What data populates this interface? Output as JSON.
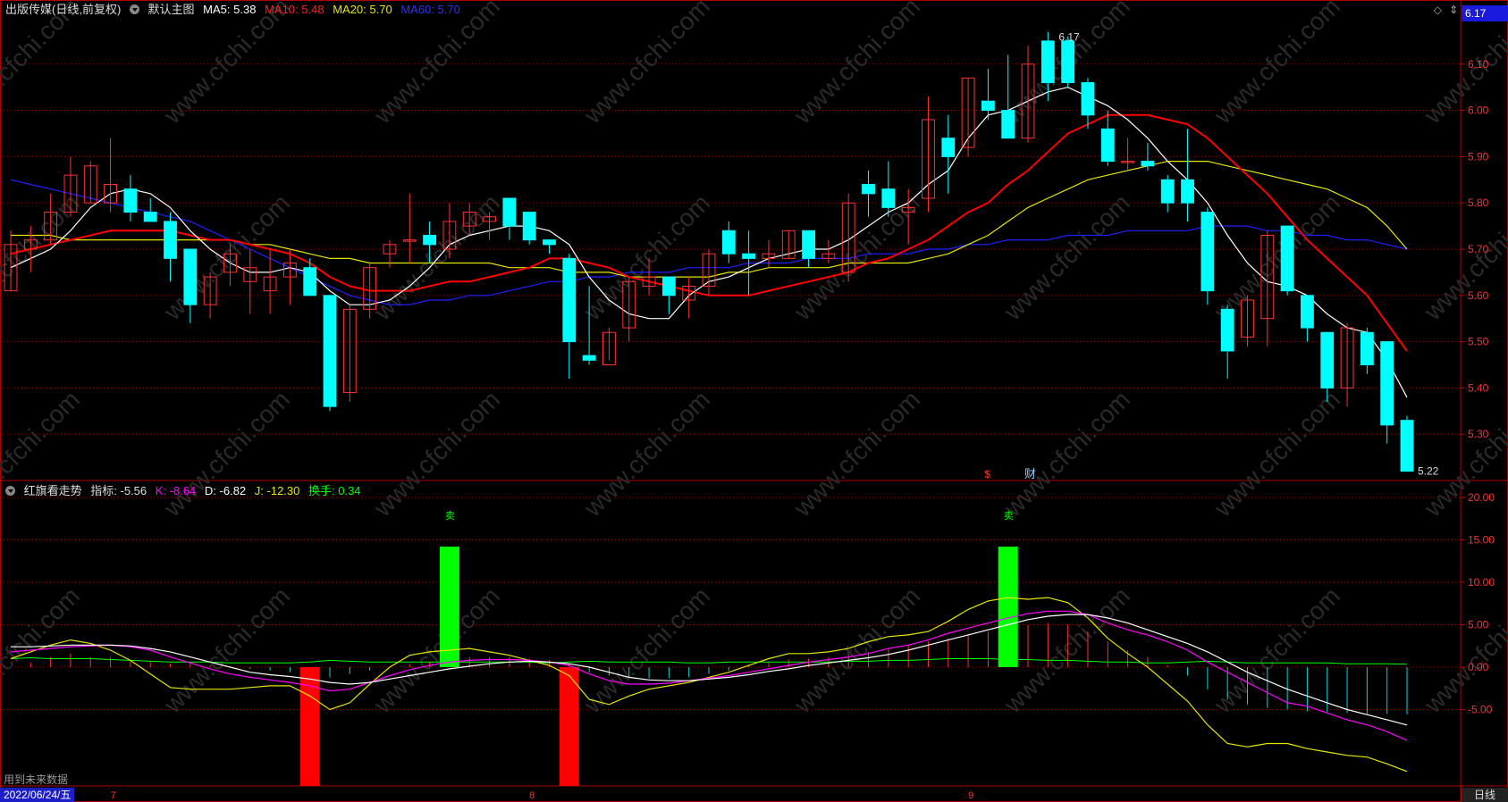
{
  "main_legend": {
    "title": "出版传媒(日线,前复权)",
    "template": "默认主图",
    "ma5": "MA5: 5.38",
    "ma10": "MA10: 5.48",
    "ma20": "MA20: 5.70",
    "ma60": "MA60: 5.70"
  },
  "current_price_tag": "6.17",
  "price_axis_ticks": [
    "6.10",
    "6.00",
    "5.90",
    "5.80",
    "5.70",
    "5.60",
    "5.50",
    "5.40",
    "5.30"
  ],
  "indicator_axis_ticks": [
    "20.00",
    "15.00",
    "10.00",
    "5.00",
    "0.00",
    "-5.00"
  ],
  "indicator_legend": {
    "name": "红旗看走势",
    "zhibiao": "指标: -5.56",
    "k": "K: -8.64",
    "d": "D: -6.82",
    "j": "J: -12.30",
    "turnover": "换手: 0.34"
  },
  "markers": {
    "high_label": "6.17",
    "low_label": "5.22",
    "event_s": "$",
    "event_cai": "财",
    "sell_1": "卖",
    "sell_2": "卖"
  },
  "bottom_bar": {
    "date": "2022/06/24/五",
    "month_7": "7",
    "month_8": "8",
    "month_9": "9",
    "period": "日线",
    "future_data": "用到未来数据"
  },
  "watermark": "www.cfchi.com",
  "colors": {
    "up": "#ff3232",
    "down": "#00ffff",
    "ma5": "#ffffff",
    "ma10": "#ff0000",
    "ma20": "#e6e600",
    "ma60": "#2020ff",
    "grid": "#8b0000",
    "signal_green": "#00ff00",
    "signal_red": "#ff0000",
    "k": "#ff00ff",
    "j": "#e6e600",
    "d": "#ffffff"
  },
  "chart_data": {
    "type": "candlestick",
    "price_ylim": [
      5.2,
      6.2
    ],
    "indicator_ylim": [
      -14,
      22
    ],
    "candles": [
      {
        "o": 5.61,
        "h": 5.74,
        "l": 5.61,
        "c": 5.71
      },
      {
        "o": 5.7,
        "h": 5.75,
        "l": 5.65,
        "c": 5.72
      },
      {
        "o": 5.72,
        "h": 5.82,
        "l": 5.71,
        "c": 5.78
      },
      {
        "o": 5.78,
        "h": 5.9,
        "l": 5.77,
        "c": 5.86
      },
      {
        "o": 5.8,
        "h": 5.89,
        "l": 5.8,
        "c": 5.88
      },
      {
        "o": 5.8,
        "h": 5.94,
        "l": 5.78,
        "c": 5.84
      },
      {
        "o": 5.83,
        "h": 5.86,
        "l": 5.76,
        "c": 5.78
      },
      {
        "o": 5.78,
        "h": 5.81,
        "l": 5.76,
        "c": 5.76
      },
      {
        "o": 5.76,
        "h": 5.78,
        "l": 5.63,
        "c": 5.68
      },
      {
        "o": 5.7,
        "h": 5.7,
        "l": 5.54,
        "c": 5.58
      },
      {
        "o": 5.58,
        "h": 5.65,
        "l": 5.55,
        "c": 5.64
      },
      {
        "o": 5.65,
        "h": 5.71,
        "l": 5.62,
        "c": 5.69
      },
      {
        "o": 5.63,
        "h": 5.7,
        "l": 5.56,
        "c": 5.66
      },
      {
        "o": 5.61,
        "h": 5.7,
        "l": 5.56,
        "c": 5.64
      },
      {
        "o": 5.64,
        "h": 5.7,
        "l": 5.58,
        "c": 5.67
      },
      {
        "o": 5.66,
        "h": 5.68,
        "l": 5.6,
        "c": 5.6
      },
      {
        "o": 5.6,
        "h": 5.6,
        "l": 5.35,
        "c": 5.36
      },
      {
        "o": 5.39,
        "h": 5.58,
        "l": 5.37,
        "c": 5.57
      },
      {
        "o": 5.57,
        "h": 5.67,
        "l": 5.55,
        "c": 5.66
      },
      {
        "o": 5.69,
        "h": 5.72,
        "l": 5.66,
        "c": 5.71
      },
      {
        "o": 5.72,
        "h": 5.82,
        "l": 5.67,
        "c": 5.72
      },
      {
        "o": 5.73,
        "h": 5.76,
        "l": 5.67,
        "c": 5.71
      },
      {
        "o": 5.7,
        "h": 5.8,
        "l": 5.68,
        "c": 5.76
      },
      {
        "o": 5.75,
        "h": 5.8,
        "l": 5.73,
        "c": 5.78
      },
      {
        "o": 5.76,
        "h": 5.78,
        "l": 5.72,
        "c": 5.77
      },
      {
        "o": 5.81,
        "h": 5.81,
        "l": 5.72,
        "c": 5.75
      },
      {
        "o": 5.78,
        "h": 5.78,
        "l": 5.71,
        "c": 5.72
      },
      {
        "o": 5.72,
        "h": 5.72,
        "l": 5.69,
        "c": 5.71
      },
      {
        "o": 5.68,
        "h": 5.69,
        "l": 5.42,
        "c": 5.5
      },
      {
        "o": 5.47,
        "h": 5.62,
        "l": 5.45,
        "c": 5.46
      },
      {
        "o": 5.45,
        "h": 5.53,
        "l": 5.46,
        "c": 5.52
      },
      {
        "o": 5.53,
        "h": 5.64,
        "l": 5.5,
        "c": 5.63
      },
      {
        "o": 5.62,
        "h": 5.68,
        "l": 5.6,
        "c": 5.64
      },
      {
        "o": 5.64,
        "h": 5.64,
        "l": 5.56,
        "c": 5.6
      },
      {
        "o": 5.59,
        "h": 5.64,
        "l": 5.55,
        "c": 5.62
      },
      {
        "o": 5.62,
        "h": 5.7,
        "l": 5.6,
        "c": 5.69
      },
      {
        "o": 5.74,
        "h": 5.76,
        "l": 5.67,
        "c": 5.69
      },
      {
        "o": 5.69,
        "h": 5.74,
        "l": 5.6,
        "c": 5.68
      },
      {
        "o": 5.68,
        "h": 5.72,
        "l": 5.66,
        "c": 5.69
      },
      {
        "o": 5.68,
        "h": 5.74,
        "l": 5.68,
        "c": 5.74
      },
      {
        "o": 5.74,
        "h": 5.74,
        "l": 5.66,
        "c": 5.68
      },
      {
        "o": 5.68,
        "h": 5.72,
        "l": 5.67,
        "c": 5.69
      },
      {
        "o": 5.65,
        "h": 5.82,
        "l": 5.63,
        "c": 5.8
      },
      {
        "o": 5.84,
        "h": 5.87,
        "l": 5.77,
        "c": 5.82
      },
      {
        "o": 5.83,
        "h": 5.89,
        "l": 5.77,
        "c": 5.79
      },
      {
        "o": 5.78,
        "h": 5.83,
        "l": 5.71,
        "c": 5.79
      },
      {
        "o": 5.81,
        "h": 6.03,
        "l": 5.78,
        "c": 5.98
      },
      {
        "o": 5.94,
        "h": 5.99,
        "l": 5.82,
        "c": 5.9
      },
      {
        "o": 5.92,
        "h": 6.07,
        "l": 5.9,
        "c": 6.07
      },
      {
        "o": 6.02,
        "h": 6.09,
        "l": 5.98,
        "c": 6.0
      },
      {
        "o": 6.0,
        "h": 6.12,
        "l": 5.95,
        "c": 5.94
      },
      {
        "o": 5.94,
        "h": 6.14,
        "l": 5.93,
        "c": 6.1
      },
      {
        "o": 6.15,
        "h": 6.17,
        "l": 6.02,
        "c": 6.06
      },
      {
        "o": 6.15,
        "h": 6.16,
        "l": 6.05,
        "c": 6.06
      },
      {
        "o": 6.06,
        "h": 6.07,
        "l": 5.96,
        "c": 5.99
      },
      {
        "o": 5.96,
        "h": 6.0,
        "l": 5.88,
        "c": 5.89
      },
      {
        "o": 5.89,
        "h": 5.94,
        "l": 5.87,
        "c": 5.89
      },
      {
        "o": 5.89,
        "h": 5.93,
        "l": 5.87,
        "c": 5.88
      },
      {
        "o": 5.85,
        "h": 5.86,
        "l": 5.78,
        "c": 5.8
      },
      {
        "o": 5.85,
        "h": 5.96,
        "l": 5.76,
        "c": 5.8
      },
      {
        "o": 5.78,
        "h": 5.79,
        "l": 5.58,
        "c": 5.61
      },
      {
        "o": 5.57,
        "h": 5.58,
        "l": 5.42,
        "c": 5.48
      },
      {
        "o": 5.51,
        "h": 5.6,
        "l": 5.49,
        "c": 5.59
      },
      {
        "o": 5.55,
        "h": 5.74,
        "l": 5.49,
        "c": 5.73
      },
      {
        "o": 5.75,
        "h": 5.75,
        "l": 5.6,
        "c": 5.61
      },
      {
        "o": 5.6,
        "h": 5.6,
        "l": 5.5,
        "c": 5.53
      },
      {
        "o": 5.52,
        "h": 5.52,
        "l": 5.37,
        "c": 5.4
      },
      {
        "o": 5.4,
        "h": 5.54,
        "l": 5.36,
        "c": 5.53
      },
      {
        "o": 5.52,
        "h": 5.53,
        "l": 5.43,
        "c": 5.45
      },
      {
        "o": 5.5,
        "h": 5.5,
        "l": 5.28,
        "c": 5.32
      },
      {
        "o": 5.33,
        "h": 5.34,
        "l": 5.22,
        "c": 5.22
      }
    ],
    "ma5": [
      5.66,
      5.68,
      5.7,
      5.74,
      5.79,
      5.82,
      5.83,
      5.82,
      5.79,
      5.74,
      5.7,
      5.67,
      5.65,
      5.65,
      5.66,
      5.65,
      5.61,
      5.58,
      5.58,
      5.59,
      5.62,
      5.66,
      5.71,
      5.73,
      5.74,
      5.75,
      5.75,
      5.74,
      5.71,
      5.64,
      5.59,
      5.56,
      5.55,
      5.55,
      5.6,
      5.63,
      5.64,
      5.66,
      5.68,
      5.69,
      5.7,
      5.7,
      5.72,
      5.75,
      5.78,
      5.8,
      5.84,
      5.87,
      5.94,
      5.99,
      6.0,
      6.02,
      6.04,
      6.05,
      6.03,
      6.01,
      5.98,
      5.94,
      5.89,
      5.85,
      5.8,
      5.73,
      5.67,
      5.63,
      5.62,
      5.6,
      5.56,
      5.53,
      5.52,
      5.46,
      5.38
    ],
    "ma10": [
      5.69,
      5.7,
      5.71,
      5.72,
      5.73,
      5.74,
      5.74,
      5.74,
      5.74,
      5.73,
      5.72,
      5.72,
      5.71,
      5.7,
      5.69,
      5.67,
      5.64,
      5.62,
      5.61,
      5.61,
      5.61,
      5.62,
      5.63,
      5.63,
      5.64,
      5.65,
      5.66,
      5.68,
      5.68,
      5.67,
      5.66,
      5.64,
      5.63,
      5.62,
      5.61,
      5.6,
      5.6,
      5.6,
      5.61,
      5.62,
      5.63,
      5.64,
      5.65,
      5.67,
      5.68,
      5.7,
      5.72,
      5.75,
      5.78,
      5.8,
      5.84,
      5.87,
      5.91,
      5.95,
      5.97,
      5.99,
      5.99,
      5.99,
      5.98,
      5.97,
      5.94,
      5.9,
      5.86,
      5.82,
      5.77,
      5.72,
      5.68,
      5.64,
      5.6,
      5.54,
      5.48
    ],
    "ma20": [
      5.73,
      5.73,
      5.73,
      5.72,
      5.72,
      5.72,
      5.72,
      5.72,
      5.72,
      5.72,
      5.72,
      5.72,
      5.71,
      5.71,
      5.7,
      5.69,
      5.68,
      5.68,
      5.67,
      5.67,
      5.67,
      5.67,
      5.67,
      5.67,
      5.67,
      5.66,
      5.66,
      5.66,
      5.65,
      5.65,
      5.65,
      5.64,
      5.64,
      5.64,
      5.64,
      5.64,
      5.65,
      5.65,
      5.66,
      5.66,
      5.66,
      5.66,
      5.67,
      5.67,
      5.67,
      5.67,
      5.68,
      5.69,
      5.71,
      5.73,
      5.76,
      5.79,
      5.81,
      5.83,
      5.85,
      5.86,
      5.87,
      5.88,
      5.89,
      5.89,
      5.89,
      5.88,
      5.87,
      5.86,
      5.85,
      5.84,
      5.83,
      5.81,
      5.79,
      5.75,
      5.7
    ],
    "ma60": [
      5.85,
      5.84,
      5.83,
      5.82,
      5.81,
      5.8,
      5.79,
      5.78,
      5.77,
      5.76,
      5.74,
      5.72,
      5.7,
      5.68,
      5.66,
      5.64,
      5.62,
      5.6,
      5.59,
      5.58,
      5.58,
      5.59,
      5.59,
      5.6,
      5.6,
      5.61,
      5.62,
      5.63,
      5.63,
      5.64,
      5.64,
      5.65,
      5.65,
      5.65,
      5.66,
      5.66,
      5.66,
      5.67,
      5.67,
      5.67,
      5.68,
      5.68,
      5.68,
      5.69,
      5.69,
      5.69,
      5.7,
      5.7,
      5.71,
      5.71,
      5.72,
      5.72,
      5.72,
      5.73,
      5.73,
      5.73,
      5.74,
      5.74,
      5.74,
      5.74,
      5.75,
      5.75,
      5.75,
      5.74,
      5.74,
      5.73,
      5.73,
      5.72,
      5.72,
      5.71,
      5.7
    ],
    "indicator": {
      "zhibiao": [
        0.0,
        0.5,
        1.2,
        1.6,
        1.2,
        1.2,
        0.8,
        0.6,
        0.4,
        0.4,
        0.2,
        0.0,
        -0.2,
        -0.4,
        -0.6,
        -1.0,
        -1.2,
        -0.8,
        -0.4,
        0.0,
        0.4,
        0.6,
        1.0,
        1.2,
        1.2,
        1.2,
        1.0,
        0.8,
        0.4,
        -0.6,
        -1.0,
        -1.2,
        -1.3,
        -1.3,
        -1.2,
        -0.8,
        -0.4,
        0.2,
        0.6,
        0.9,
        1.0,
        1.2,
        1.5,
        1.8,
        2.2,
        2.6,
        3.0,
        3.4,
        3.8,
        4.2,
        4.6,
        5.0,
        5.2,
        5.0,
        4.2,
        3.0,
        2.0,
        1.2,
        0.2,
        -1.0,
        -2.6,
        -3.8,
        -4.4,
        -4.8,
        -5.0,
        -5.2,
        -5.3,
        -5.4,
        -5.5,
        -5.5,
        -5.56
      ],
      "k": [
        1.8,
        2.0,
        2.2,
        2.4,
        2.5,
        2.6,
        2.4,
        2.0,
        1.2,
        0.5,
        -0.2,
        -0.8,
        -1.2,
        -1.5,
        -1.8,
        -2.2,
        -2.8,
        -2.6,
        -1.8,
        -1.0,
        -0.3,
        0.2,
        0.6,
        0.8,
        0.9,
        0.9,
        0.8,
        0.6,
        0.2,
        -0.8,
        -1.6,
        -2.0,
        -2.0,
        -1.9,
        -1.6,
        -1.3,
        -1.0,
        -0.6,
        -0.2,
        0.2,
        0.6,
        0.9,
        1.2,
        1.6,
        2.2,
        2.6,
        3.2,
        4.0,
        4.6,
        5.2,
        5.8,
        6.3,
        6.6,
        6.6,
        6.2,
        5.2,
        4.4,
        3.8,
        3.0,
        2.0,
        0.6,
        -0.6,
        -1.8,
        -3.0,
        -4.2,
        -4.6,
        -5.4,
        -6.2,
        -6.8,
        -7.6,
        -8.64
      ],
      "d": [
        2.4,
        2.4,
        2.5,
        2.6,
        2.6,
        2.6,
        2.5,
        2.2,
        1.8,
        1.2,
        0.6,
        0.0,
        -0.6,
        -0.9,
        -1.1,
        -1.4,
        -1.8,
        -2.0,
        -1.8,
        -1.4,
        -1.0,
        -0.6,
        -0.2,
        0.1,
        0.4,
        0.6,
        0.7,
        0.6,
        0.4,
        0.0,
        -0.6,
        -1.2,
        -1.5,
        -1.6,
        -1.6,
        -1.4,
        -1.2,
        -0.9,
        -0.5,
        -0.2,
        0.2,
        0.5,
        0.8,
        1.1,
        1.5,
        2.0,
        2.6,
        3.2,
        3.8,
        4.4,
        5.0,
        5.6,
        6.0,
        6.2,
        6.2,
        5.8,
        5.2,
        4.4,
        3.6,
        2.8,
        1.8,
        0.6,
        -0.6,
        -1.6,
        -2.6,
        -3.4,
        -4.2,
        -5.0,
        -5.6,
        -6.2,
        -6.82
      ],
      "j": [
        1.0,
        1.8,
        2.6,
        3.2,
        2.8,
        2.0,
        0.8,
        -0.8,
        -2.4,
        -2.6,
        -2.6,
        -2.6,
        -2.4,
        -2.2,
        -2.2,
        -3.4,
        -5.0,
        -4.2,
        -2.0,
        0.0,
        1.4,
        1.8,
        2.0,
        2.2,
        1.8,
        1.4,
        0.8,
        0.2,
        -1.0,
        -3.8,
        -4.4,
        -3.4,
        -2.6,
        -2.2,
        -1.8,
        -1.2,
        -0.6,
        0.2,
        1.0,
        1.6,
        1.6,
        1.8,
        2.2,
        3.0,
        3.6,
        3.8,
        4.2,
        5.4,
        6.8,
        7.8,
        8.2,
        8.0,
        8.2,
        7.6,
        5.8,
        3.4,
        1.6,
        0.0,
        -2.0,
        -4.0,
        -6.8,
        -9.0,
        -9.4,
        -9.0,
        -9.0,
        -9.6,
        -10.0,
        -10.4,
        -10.6,
        -11.4,
        -12.3
      ],
      "turnover": [
        1.0,
        1.1,
        1.0,
        1.0,
        1.0,
        0.9,
        0.8,
        0.7,
        0.6,
        0.6,
        0.6,
        0.5,
        0.5,
        0.5,
        0.5,
        0.6,
        0.8,
        0.7,
        0.6,
        0.6,
        0.6,
        0.6,
        0.6,
        0.6,
        0.6,
        0.6,
        0.6,
        0.5,
        0.6,
        0.7,
        0.6,
        0.6,
        0.6,
        0.6,
        0.5,
        0.5,
        0.6,
        0.6,
        0.6,
        0.6,
        0.6,
        0.6,
        0.7,
        0.7,
        0.8,
        0.8,
        0.9,
        1.0,
        1.0,
        1.0,
        0.9,
        0.9,
        0.8,
        0.8,
        0.7,
        0.6,
        0.6,
        0.5,
        0.5,
        0.6,
        0.7,
        0.6,
        0.5,
        0.5,
        0.5,
        0.5,
        0.5,
        0.4,
        0.4,
        0.4,
        0.34
      ],
      "signals": [
        {
          "index": 15,
          "type": "buy",
          "value": -14
        },
        {
          "index": 22,
          "type": "sell",
          "value": 14.2
        },
        {
          "index": 28,
          "type": "buy",
          "value": -14
        },
        {
          "index": 50,
          "type": "sell",
          "value": 14.2
        }
      ]
    }
  }
}
